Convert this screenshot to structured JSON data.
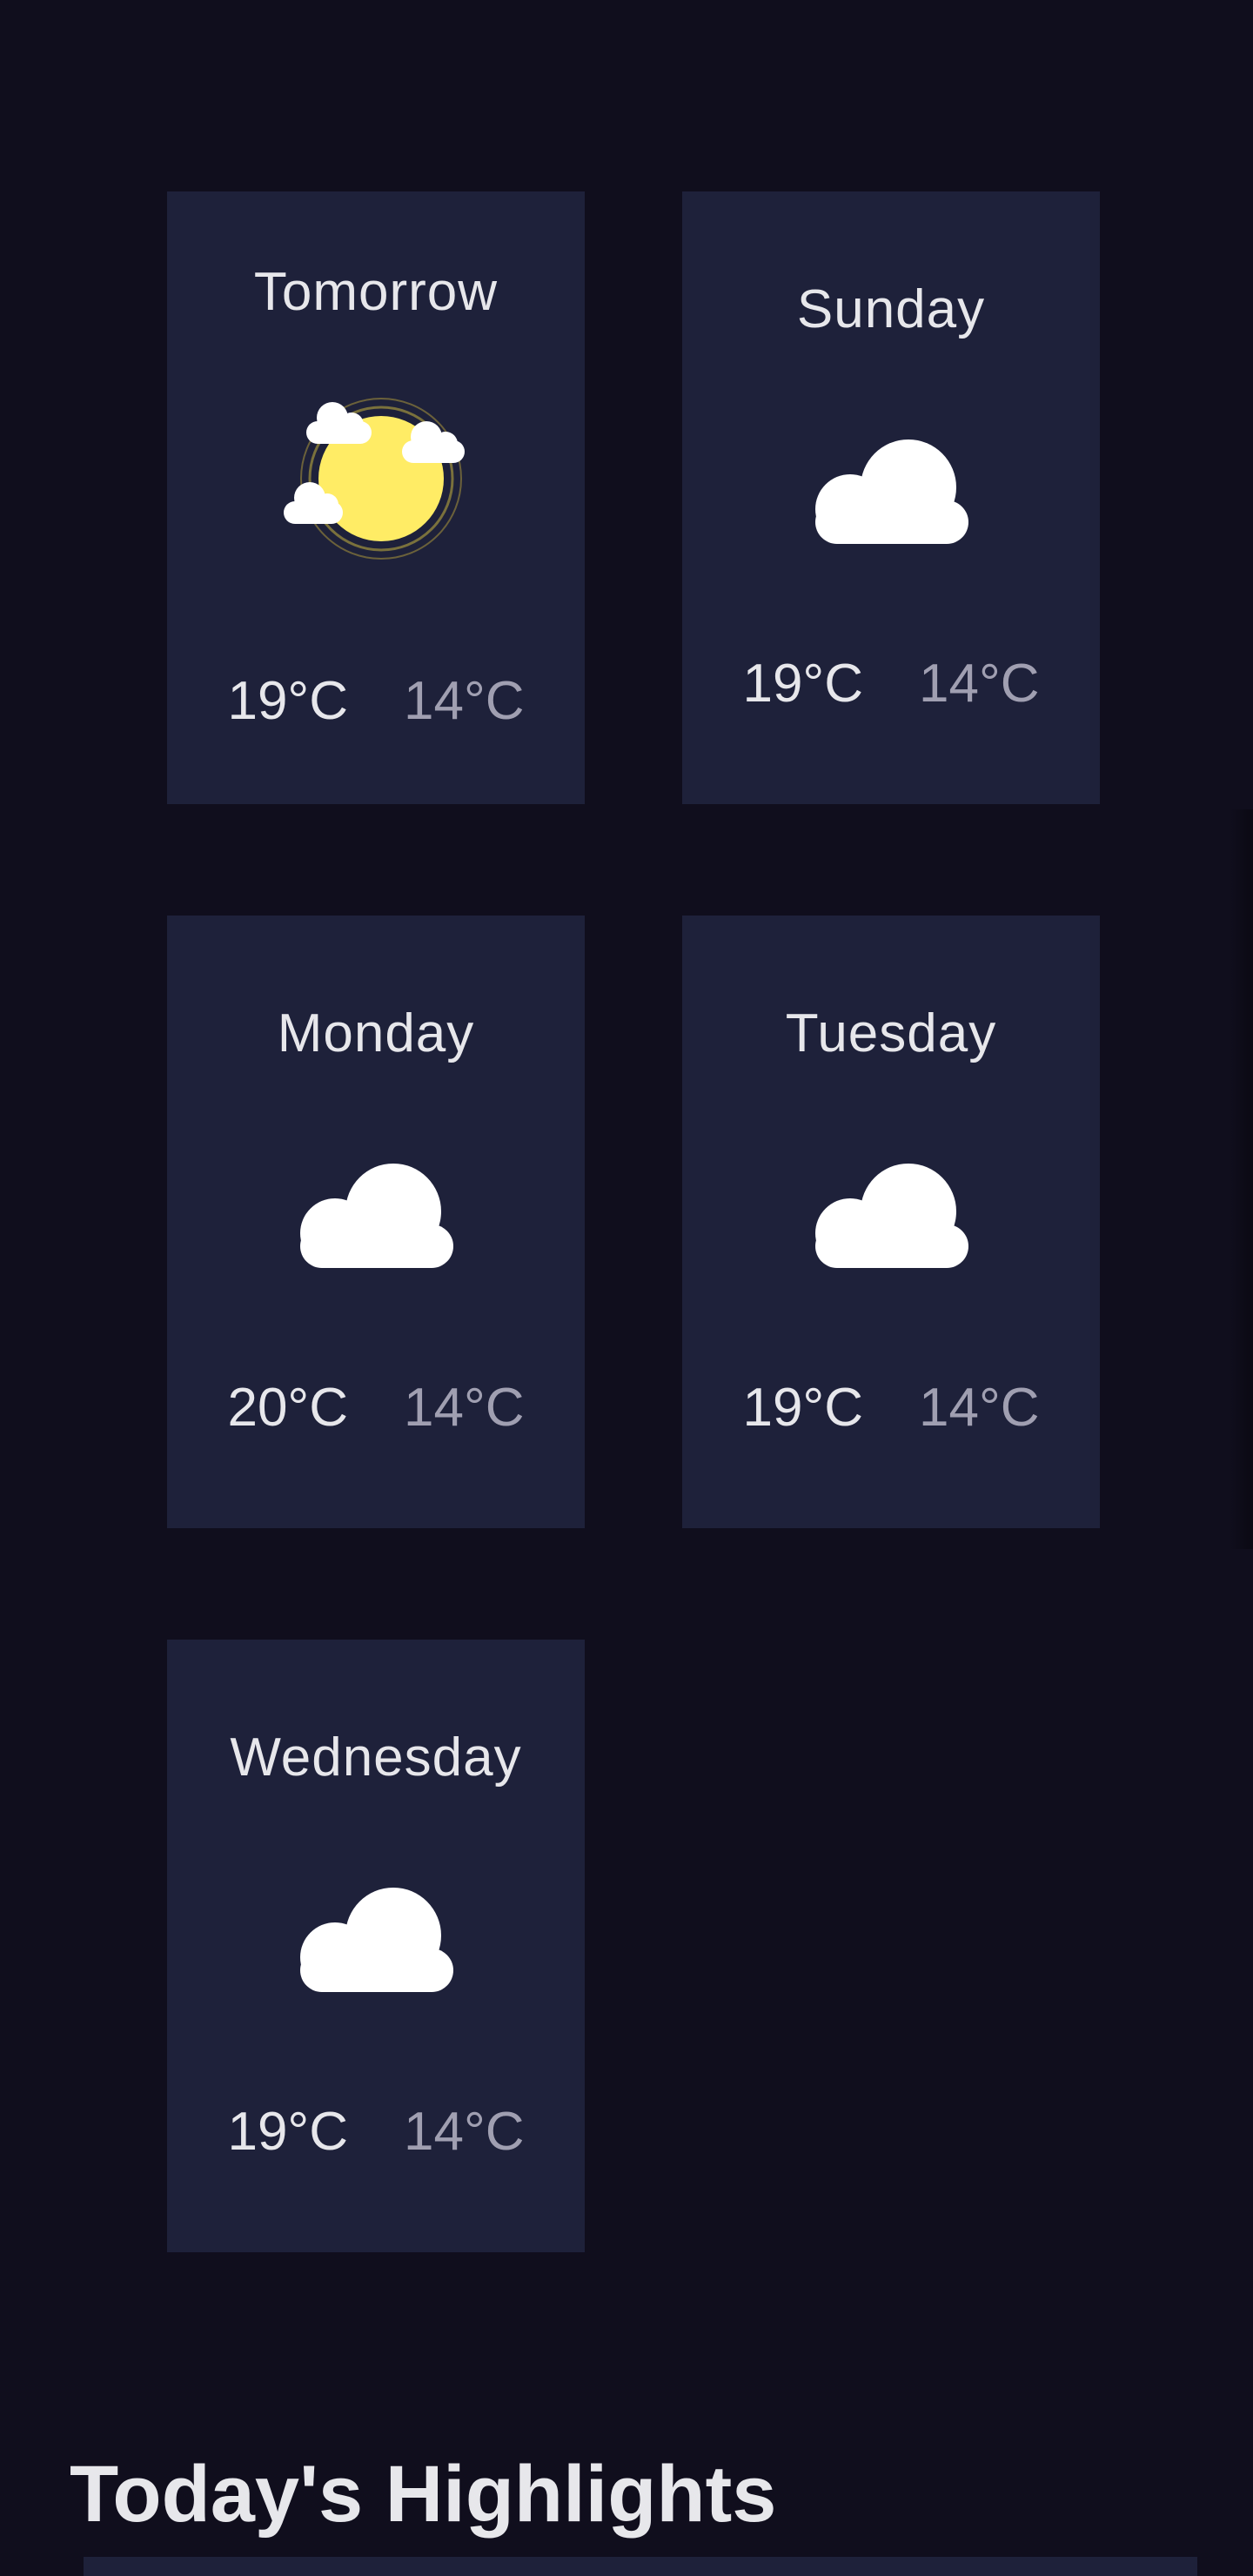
{
  "forecast": [
    {
      "day": "Tomorrow",
      "max": "19°C",
      "min": "14°C",
      "icon": "light-cloud-sun-icon"
    },
    {
      "day": "Sunday",
      "max": "19°C",
      "min": "14°C",
      "icon": "cloud-icon"
    },
    {
      "day": "Monday",
      "max": "20°C",
      "min": "14°C",
      "icon": "cloud-icon"
    },
    {
      "day": "Tuesday",
      "max": "19°C",
      "min": "14°C",
      "icon": "cloud-icon"
    },
    {
      "day": "Wednesday",
      "max": "19°C",
      "min": "14°C",
      "icon": "cloud-icon"
    }
  ],
  "highlights": {
    "title": "Today's Highlights"
  },
  "colors": {
    "background": "#100E1D",
    "card": "#1E213A",
    "text": "#E7E7EB",
    "muted": "#A09FB1",
    "sun": "#FFEC65"
  }
}
